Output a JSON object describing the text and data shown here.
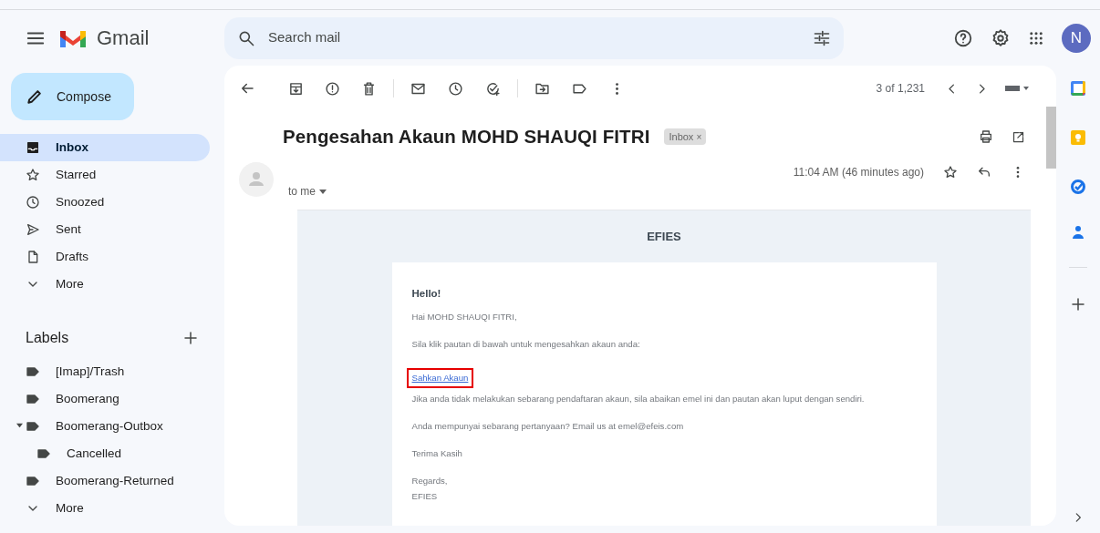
{
  "app": {
    "name": "Gmail",
    "avatar_letter": "N"
  },
  "search": {
    "placeholder": "Search mail"
  },
  "compose": "Compose",
  "nav": [
    {
      "label": "Inbox",
      "selected": true
    },
    {
      "label": "Starred",
      "selected": false
    },
    {
      "label": "Snoozed",
      "selected": false
    },
    {
      "label": "Sent",
      "selected": false
    },
    {
      "label": "Drafts",
      "selected": false
    },
    {
      "label": "More",
      "selected": false
    }
  ],
  "labels": {
    "title": "Labels",
    "items": [
      {
        "label": "[Imap]/Trash"
      },
      {
        "label": "Boomerang"
      },
      {
        "label": "Boomerang-Outbox",
        "expanded": true,
        "children": [
          {
            "label": "Cancelled"
          }
        ]
      },
      {
        "label": "Boomerang-Returned"
      }
    ],
    "more": "More"
  },
  "pager": "3 of 1,231",
  "message": {
    "subject": "Pengesahan Akaun MOHD SHAUQI FITRI",
    "chip": "Inbox",
    "chip_close": "×",
    "recipient": "to me",
    "time": "11:04 AM (46 minutes ago)"
  },
  "email": {
    "brand": "EFIES",
    "lines": [
      {
        "kind": "greeting",
        "text": "Hello!"
      },
      {
        "kind": "text",
        "text": "Hai MOHD SHAUQI FITRI,"
      },
      {
        "kind": "text",
        "text": "Sila klik pautan di bawah untuk mengesahkan akaun anda:"
      },
      {
        "kind": "link",
        "text": "Sahkan Akaun",
        "highlighted": true
      },
      {
        "kind": "text",
        "text": "Jika anda tidak melakukan sebarang pendaftaran akaun, sila abaikan emel ini dan pautan akan luput dengan sendiri."
      },
      {
        "kind": "text",
        "text": "Anda mempunyai sebarang pertanyaan? Email us at emel@efeis.com"
      },
      {
        "kind": "text",
        "text": "Terima Kasih"
      },
      {
        "kind": "signature",
        "text": "Regards,"
      },
      {
        "kind": "signature",
        "text": "EFIES"
      }
    ]
  }
}
